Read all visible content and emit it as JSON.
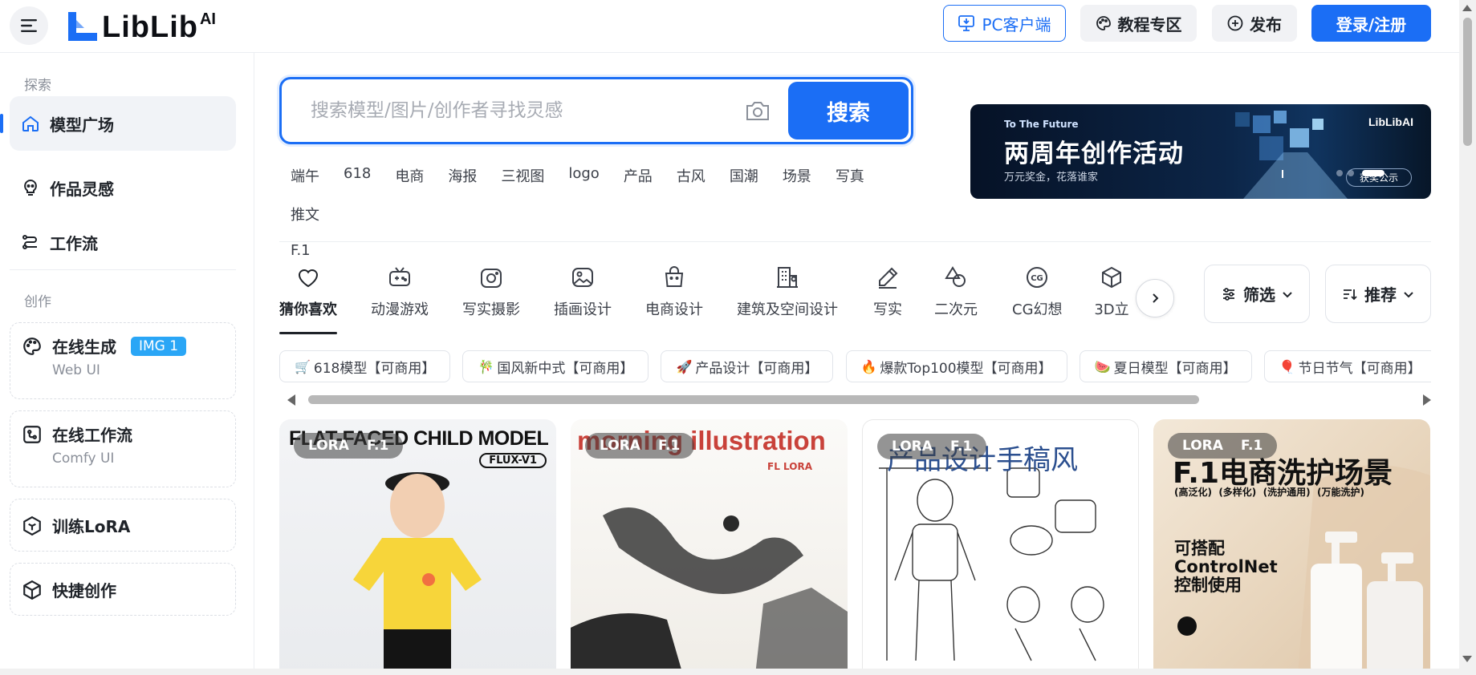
{
  "brand": {
    "logo_text": "LibLib",
    "logo_ai": "AI"
  },
  "header": {
    "pc_client": "PC客户端",
    "tutorials": "教程专区",
    "publish": "发布",
    "login": "登录/注册"
  },
  "sidebar": {
    "explore_title": "探索",
    "explore_items": [
      {
        "label": "模型广场",
        "icon": "home-icon"
      },
      {
        "label": "作品灵感",
        "icon": "inspiration-icon"
      },
      {
        "label": "工作流",
        "icon": "workflow-icon"
      }
    ],
    "create_title": "创作",
    "online_gen": {
      "label": "在线生成",
      "badge": "IMG 1",
      "sub": "Web UI"
    },
    "online_workflow": {
      "label": "在线工作流",
      "sub": "Comfy UI"
    },
    "train_lora": {
      "label": "训练LoRA"
    },
    "quick_create": {
      "label": "快捷创作"
    }
  },
  "search": {
    "placeholder": "搜索模型/图片/创作者寻找灵感",
    "button": "搜索"
  },
  "hot_tags": [
    "端午",
    "618",
    "电商",
    "海报",
    "三视图",
    "logo",
    "产品",
    "古风",
    "国潮",
    "场景",
    "写真",
    "推文",
    "F.1"
  ],
  "banner": {
    "kicker": "To The Future",
    "title": "两周年创作活动",
    "subtitle": "万元奖金，花落谁家",
    "logo": "LibLibAI",
    "button": "获奖公示"
  },
  "categories": [
    {
      "label": "猜你喜欢",
      "icon": "heart-icon"
    },
    {
      "label": "动漫游戏",
      "icon": "game-icon"
    },
    {
      "label": "写实摄影",
      "icon": "camera-icon"
    },
    {
      "label": "插画设计",
      "icon": "image-icon"
    },
    {
      "label": "电商设计",
      "icon": "bag-icon"
    },
    {
      "label": "建筑及空间设计",
      "icon": "building-icon"
    },
    {
      "label": "写实",
      "icon": "pen-icon"
    },
    {
      "label": "二次元",
      "icon": "shapes-icon"
    },
    {
      "label": "CG幻想",
      "icon": "cg-icon"
    },
    {
      "label": "3D立",
      "icon": "cube-icon"
    }
  ],
  "filters": {
    "filter": "筛选",
    "sort": "推荐"
  },
  "chips": [
    {
      "emoji": "🛒",
      "label": "618模型【可商用】"
    },
    {
      "emoji": "🎋",
      "label": "国风新中式【可商用】"
    },
    {
      "emoji": "🚀",
      "label": "产品设计【可商用】"
    },
    {
      "emoji": "🔥",
      "label": "爆款Top100模型【可商用】"
    },
    {
      "emoji": "🍉",
      "label": "夏日模型【可商用】"
    },
    {
      "emoji": "🎈",
      "label": "节日节气【可商用】"
    }
  ],
  "cards": [
    {
      "tag1": "LORA",
      "tag2": "F.1",
      "title": "FLAT-FACED CHILD MODEL",
      "sub": "FLUX-V1"
    },
    {
      "tag1": "LORA",
      "tag2": "F.1",
      "title": "morning illustration",
      "sub": "FL LORA"
    },
    {
      "tag1": "LORA",
      "tag2": "F.1",
      "title": "产品设计手稿风",
      "sub": ""
    },
    {
      "tag1": "LORA",
      "tag2": "F.1",
      "title": "F.1电商洗护场景",
      "sub": "(高泛化)  (多样化)  (洗护通用)  (万能洗护)",
      "note": "可搭配 ControlNet 控制使用"
    }
  ],
  "colors": {
    "accent": "#1b6ef5",
    "img_badge": "#2aa6f6"
  }
}
